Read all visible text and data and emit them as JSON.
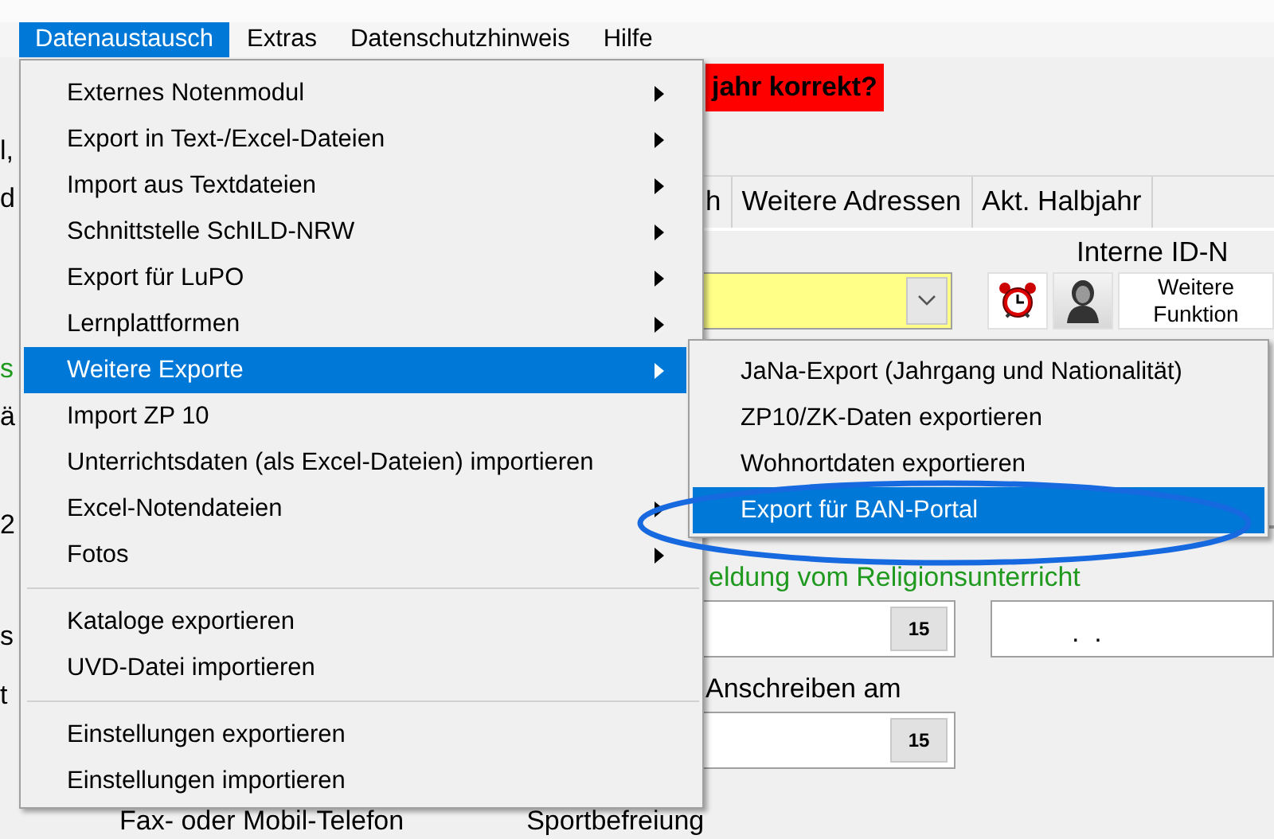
{
  "menubar": [
    {
      "label": "Datenaustausch",
      "selected": true
    },
    {
      "label": "Extras",
      "selected": false
    },
    {
      "label": "Datenschutzhinweis",
      "selected": false
    },
    {
      "label": "Hilfe",
      "selected": false
    }
  ],
  "banner": "jahr korrekt?",
  "left_fragments": [
    {
      "text": "l,",
      "kind": "plain"
    },
    {
      "text": "d",
      "kind": "plain"
    },
    {
      "text": "s",
      "kind": "green"
    },
    {
      "text": "ä",
      "kind": "plain"
    },
    {
      "text": "2",
      "kind": "plain"
    },
    {
      "text": "s",
      "kind": "plain"
    },
    {
      "text": "t",
      "kind": "plain"
    }
  ],
  "tabs": [
    {
      "label": "h"
    },
    {
      "label": "Weitere Adressen"
    },
    {
      "label": "Akt. Halbjahr"
    }
  ],
  "id_label": "Interne ID-N",
  "functions_button": "Weitere\nFunktion",
  "religion_label": "eldung vom Religionsunterricht",
  "religion_date": {
    "calendar": "15"
  },
  "other_date": {
    "value": ".  ."
  },
  "letter_label": "Anschreiben am",
  "letter_date": {
    "calendar": "15"
  },
  "bottom_labels": [
    "Fax- oder Mobil-Telefon",
    "Sportbefreiung"
  ],
  "menu": {
    "items": [
      {
        "kind": "item",
        "label": "Externes Notenmodul",
        "submenu": true,
        "selected": false
      },
      {
        "kind": "item",
        "label": "Export in Text-/Excel-Dateien",
        "submenu": true,
        "selected": false
      },
      {
        "kind": "item",
        "label": "Import aus Textdateien",
        "submenu": true,
        "selected": false
      },
      {
        "kind": "item",
        "label": "Schnittstelle SchILD-NRW",
        "submenu": true,
        "selected": false
      },
      {
        "kind": "item",
        "label": "Export für LuPO",
        "submenu": true,
        "selected": false
      },
      {
        "kind": "item",
        "label": "Lernplattformen",
        "submenu": true,
        "selected": false
      },
      {
        "kind": "item",
        "label": "Weitere Exporte",
        "submenu": true,
        "selected": true
      },
      {
        "kind": "item",
        "label": "Import ZP 10",
        "submenu": false,
        "selected": false
      },
      {
        "kind": "item",
        "label": "Unterrichtsdaten (als Excel-Dateien) importieren",
        "submenu": false,
        "selected": false
      },
      {
        "kind": "item",
        "label": "Excel-Notendateien",
        "submenu": true,
        "selected": false
      },
      {
        "kind": "item",
        "label": "Fotos",
        "submenu": true,
        "selected": false
      },
      {
        "kind": "separator"
      },
      {
        "kind": "item",
        "label": "Kataloge exportieren",
        "submenu": false,
        "selected": false
      },
      {
        "kind": "item",
        "label": "UVD-Datei importieren",
        "submenu": false,
        "selected": false
      },
      {
        "kind": "separator"
      },
      {
        "kind": "item",
        "label": "Einstellungen exportieren",
        "submenu": false,
        "selected": false
      },
      {
        "kind": "item",
        "label": "Einstellungen importieren",
        "submenu": false,
        "selected": false
      }
    ]
  },
  "submenu": {
    "items": [
      {
        "label": "JaNa-Export (Jahrgang und Nationalität)",
        "selected": false
      },
      {
        "label": "ZP10/ZK-Daten exportieren",
        "selected": false
      },
      {
        "label": "Wohnortdaten exportieren",
        "selected": false
      },
      {
        "label": "Export für BAN-Portal",
        "selected": true,
        "circled": true
      }
    ]
  }
}
